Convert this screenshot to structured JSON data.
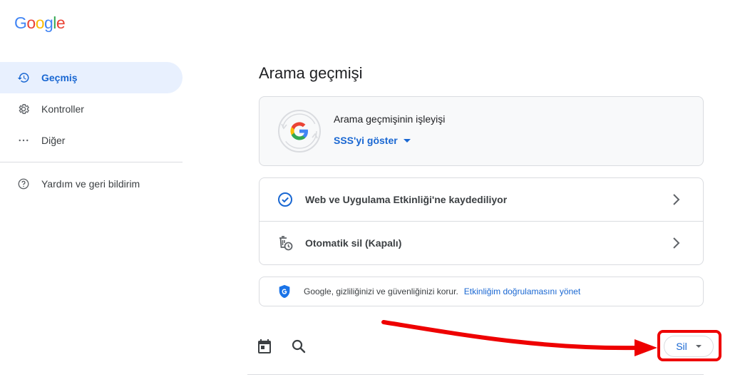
{
  "logo": {
    "letters": [
      {
        "ch": "G",
        "color": "#4285F4"
      },
      {
        "ch": "o",
        "color": "#EA4335"
      },
      {
        "ch": "o",
        "color": "#FBBC05"
      },
      {
        "ch": "g",
        "color": "#4285F4"
      },
      {
        "ch": "l",
        "color": "#34A853"
      },
      {
        "ch": "e",
        "color": "#EA4335"
      }
    ]
  },
  "sidebar": {
    "items": [
      {
        "label": "Geçmiş",
        "icon": "history-icon",
        "active": true
      },
      {
        "label": "Kontroller",
        "icon": "gear-icon",
        "active": false
      },
      {
        "label": "Diğer",
        "icon": "more-horizontal-icon",
        "active": false
      }
    ],
    "help": {
      "label": "Yardım ve geri bildirim",
      "icon": "help-circle-icon"
    }
  },
  "main": {
    "title": "Arama geçmişi",
    "info_card": {
      "title": "Arama geçmişinin işleyişi",
      "link": "SSS'yi göster"
    },
    "settings": [
      {
        "label": "Web ve Uygulama Etkinliği'ne kaydediliyor",
        "icon": "check-circle-icon"
      },
      {
        "label": "Otomatik sil (Kapalı)",
        "icon": "auto-delete-icon"
      }
    ],
    "privacy": {
      "text": "Google, gizliliğinizi ve güvenliğinizi korur.",
      "link": "Etkinliğim doğrulamasını yönet"
    },
    "toolbar": {
      "delete_label": "Sil"
    }
  },
  "colors": {
    "accent": "#1967d2",
    "active_bg": "#e8f0fe",
    "annotation_red": "#ee0000"
  }
}
